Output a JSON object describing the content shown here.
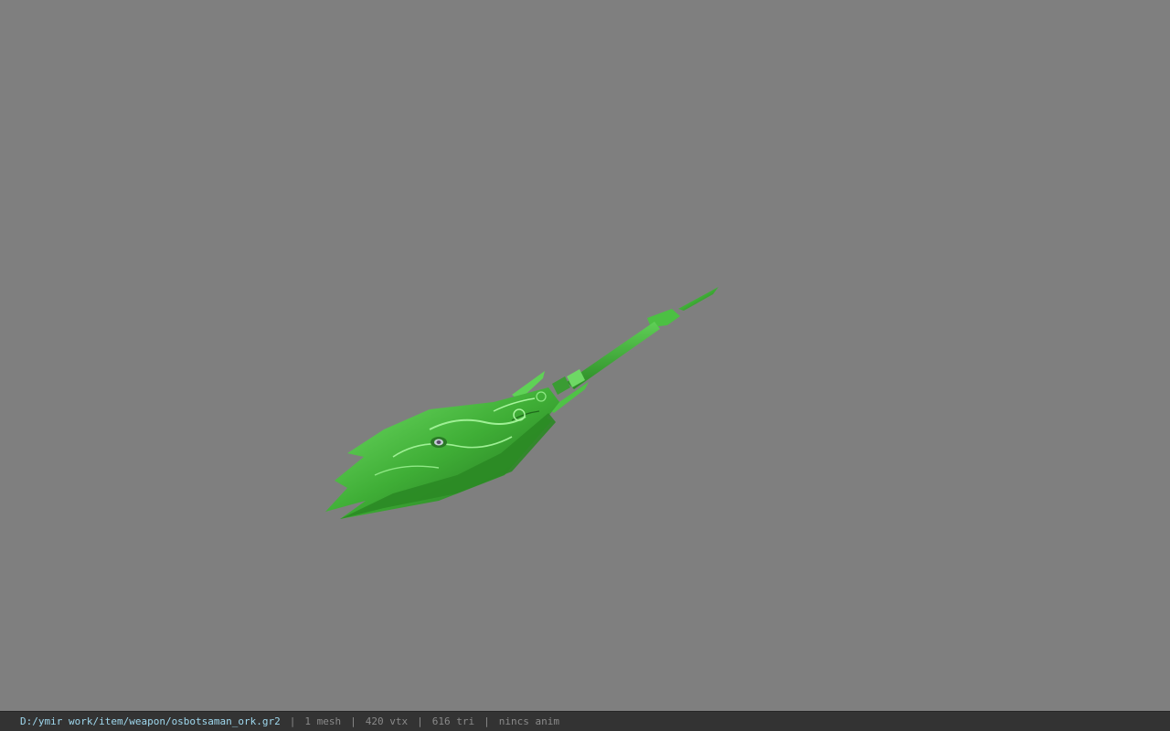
{
  "viewer": {
    "background_color": "#7f7f7f",
    "model_color": "#3fae36",
    "model_highlight": "#74e06a",
    "model_shadow": "#1f6a1c"
  },
  "status_bar": {
    "file_path": "D:/ymir work/item/weapon/osbotsaman_ork.gr2",
    "separator": "|",
    "mesh_count": "1 mesh",
    "vertex_count": "420 vtx",
    "triangle_count": "616 tri",
    "anim_status": "nincs anim",
    "path_color": "#9fd8ee",
    "text_color": "#8a8a8a",
    "bar_color": "#333333"
  }
}
